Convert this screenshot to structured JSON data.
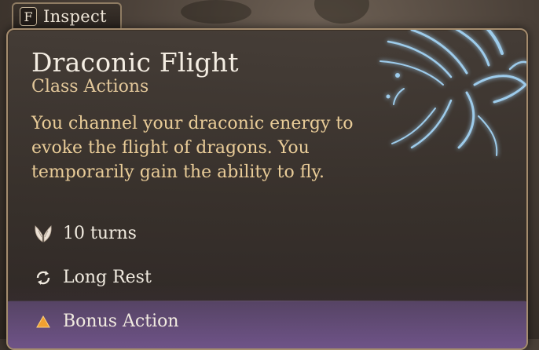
{
  "inspect": {
    "key": "F",
    "label": "Inspect"
  },
  "tooltip": {
    "title": "Draconic Flight",
    "category": "Class Actions",
    "description": "You channel your draconic energy to evoke the flight of dragons. You temporarily gain the ability to fly.",
    "duration": "10 turns",
    "recharge": "Long Rest",
    "action_cost": "Bonus Action"
  },
  "icons": {
    "duration": "wings-icon",
    "recharge": "refresh-icon",
    "action_cost": "triangle-icon",
    "art": "spectral-dragon-icon"
  },
  "colors": {
    "title": "#f4ede2",
    "subtitle": "#e2c79a",
    "description": "#e9cc98",
    "border": "#a48c6e",
    "action_bar": "#7a5a96",
    "action_icon": "#f0a030",
    "art_glow": "#a8dcff"
  }
}
